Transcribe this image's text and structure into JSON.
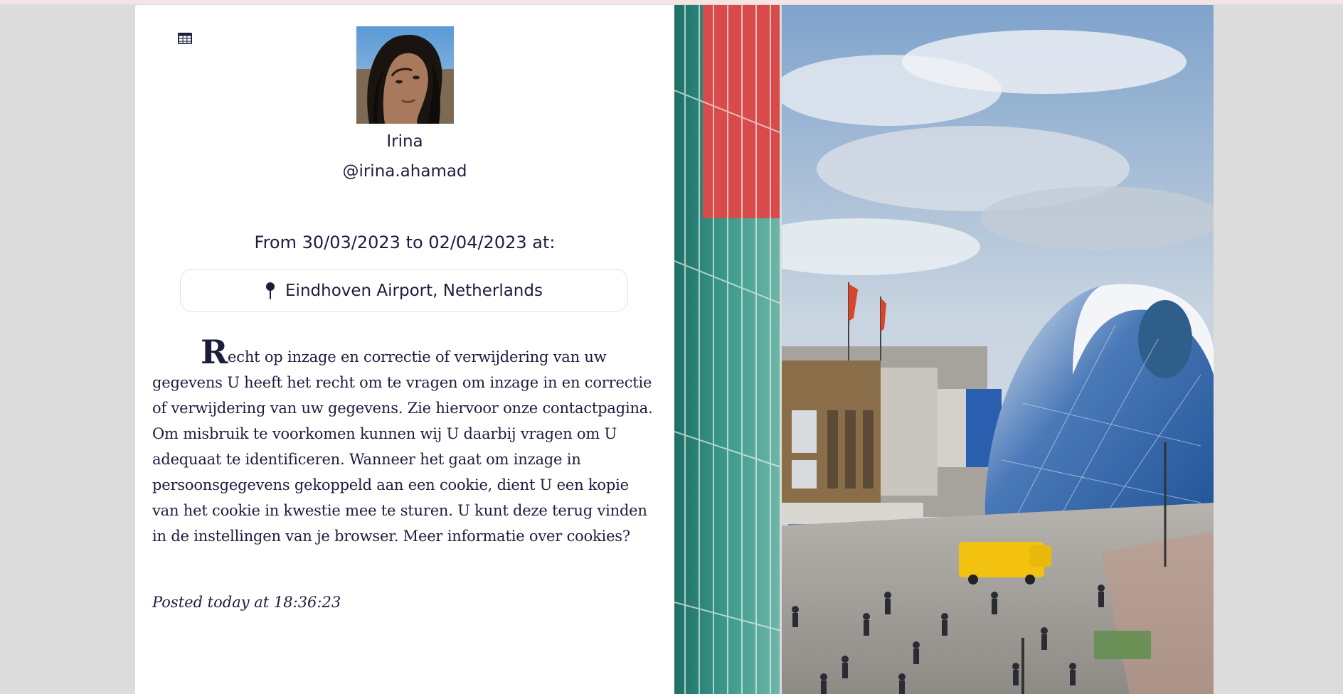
{
  "user": {
    "name": "Irina",
    "handle": "@irina.ahamad"
  },
  "trip": {
    "date_range": "From 30/03/2023 to 02/04/2023 at:",
    "location": "Eindhoven Airport, Netherlands"
  },
  "post": {
    "drop_cap": "R",
    "body": "echt op inzage en correctie of verwijdering van uw gegevens U heeft het recht om te vragen om inzage in en correctie of verwijdering van uw gegevens. Zie hiervoor onze contactpagina. Om misbruik te voorkomen kunnen wij U daarbij vragen om U adequaat te identificeren. Wanneer het gaat om inzage in persoonsgegevens gekoppeld aan een cookie, dient U een kopie van het cookie in kwestie mee te sturen. U kunt deze terug vinden in de instellingen van je browser. Meer informatie over cookies?",
    "posted": "Posted today at 18:36:23"
  },
  "icons": {
    "grid": "grid-icon",
    "location": "map-pin-icon"
  },
  "colors": {
    "text": "#1b1d3d",
    "page_background": "#dcdcdc",
    "card_background": "#ffffff",
    "border": "#e3e3e6"
  }
}
